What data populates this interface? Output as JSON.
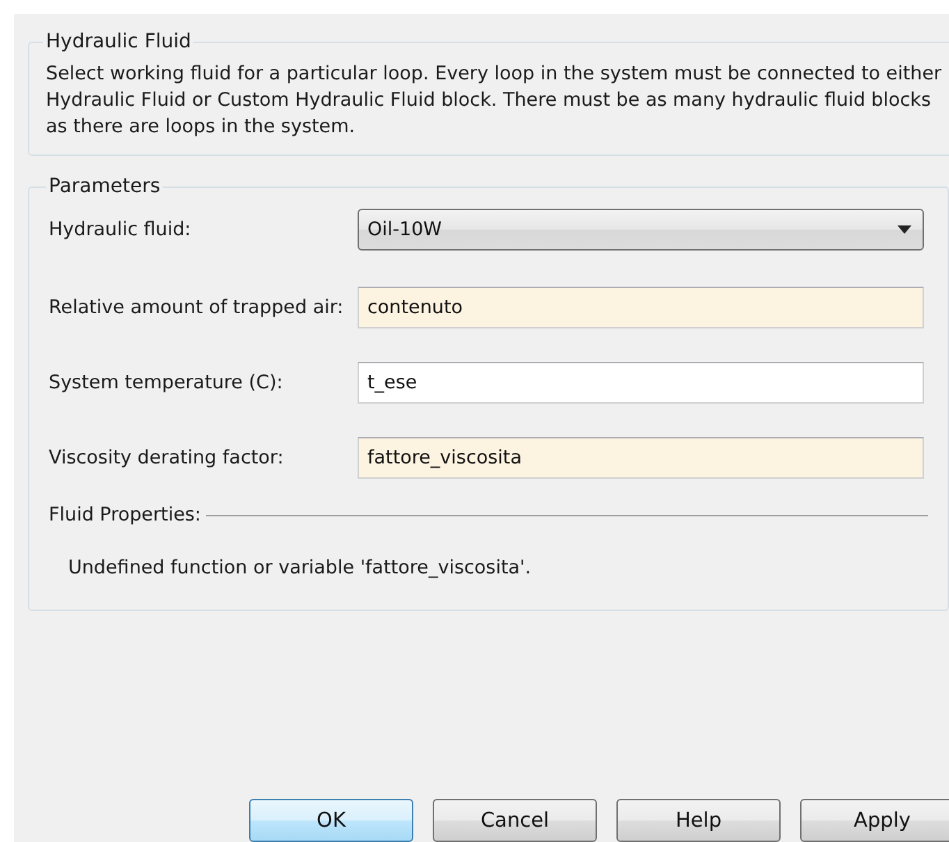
{
  "description_group": {
    "title": "Hydraulic Fluid",
    "text": "Select working fluid for a particular loop. Every loop in the system must be connected to either Hydraulic Fluid or Custom Hydraulic Fluid block. There must be as many hydraulic fluid blocks as there are loops in the system."
  },
  "parameters": {
    "title": "Parameters",
    "rows": [
      {
        "kind": "dropdown",
        "label": "Hydraulic fluid:",
        "value": "Oil-10W",
        "highlighted": false
      },
      {
        "kind": "text",
        "label": "Relative amount of trapped air:",
        "value": "contenuto",
        "highlighted": true
      },
      {
        "kind": "text",
        "label": "System temperature (C):",
        "value": "t_ese",
        "highlighted": false
      },
      {
        "kind": "text",
        "label": "Viscosity derating factor:",
        "value": "fattore_viscosita",
        "highlighted": true
      }
    ],
    "fluid_properties": {
      "title": "Fluid Properties:",
      "message": "Undefined function or variable 'fattore_viscosita'."
    }
  },
  "buttons": [
    {
      "label": "OK",
      "default": true
    },
    {
      "label": "Cancel",
      "default": false
    },
    {
      "label": "Help",
      "default": false
    },
    {
      "label": "Apply",
      "default": false
    }
  ]
}
